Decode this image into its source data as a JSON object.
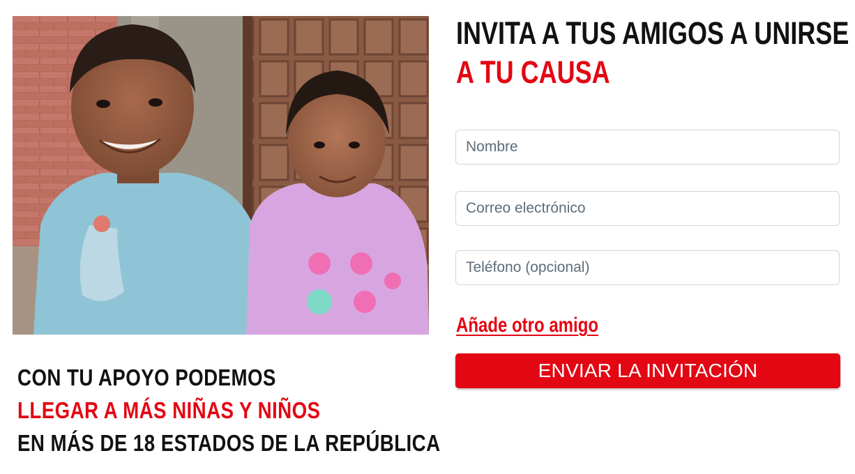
{
  "colors": {
    "accent": "#e30613",
    "text": "#111111"
  },
  "photo": {
    "icon": "photo-two-children-smiling"
  },
  "caption": {
    "line1": "CON TU APOYO PODEMOS",
    "line2": "LLEGAR A MÁS NIÑAS Y NIÑOS",
    "line3": "EN MÁS DE 18 ESTADOS DE LA REPÚBLICA"
  },
  "heading": {
    "line1": "INVITA A TUS AMIGOS A UNIRSE",
    "line2": "A TU CAUSA"
  },
  "form": {
    "name_placeholder": "Nombre",
    "email_placeholder": "Correo electrónico",
    "phone_placeholder": "Teléfono (opcional)",
    "add_friend_label": "Añade otro amigo",
    "submit_label": "ENVIAR LA INVITACIÓN"
  }
}
